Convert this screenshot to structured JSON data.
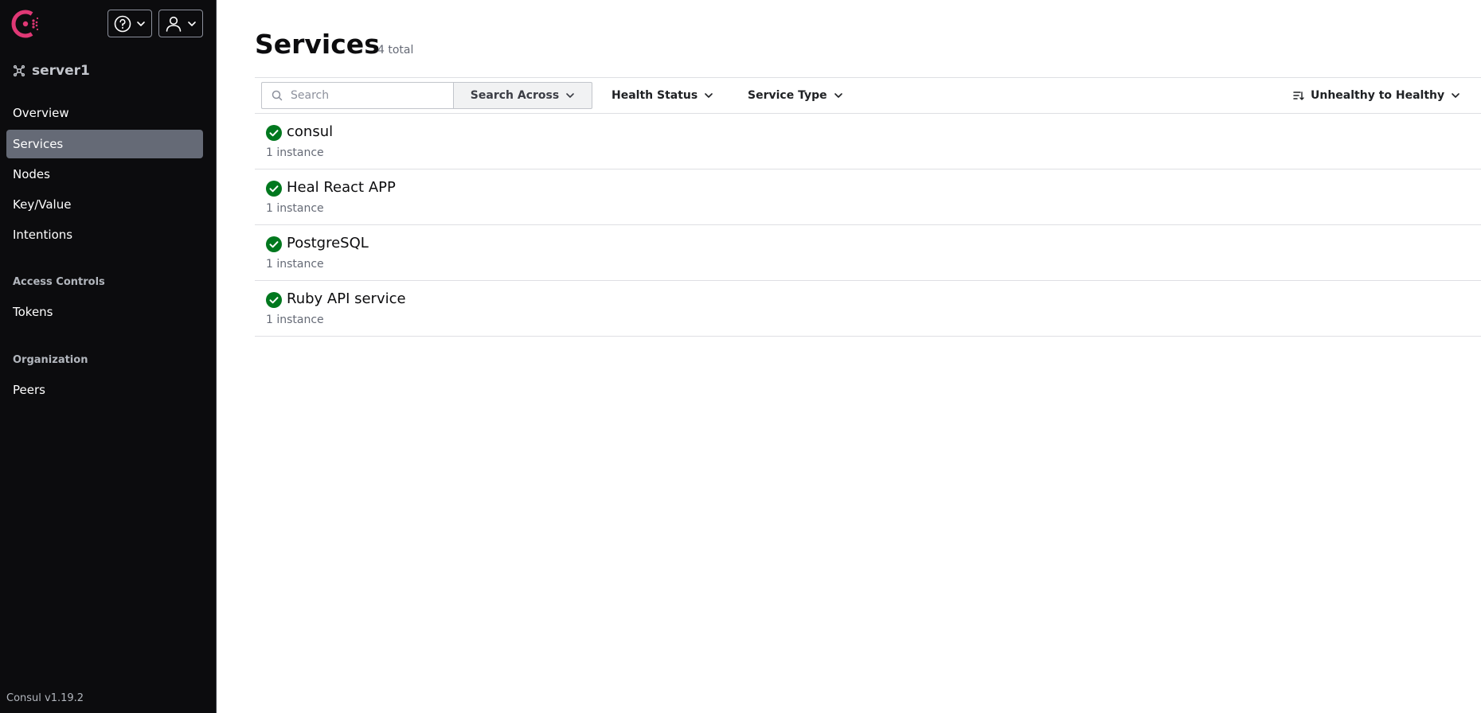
{
  "sidebar": {
    "datacenter": "server1",
    "nav": [
      {
        "label": "Overview",
        "active": false
      },
      {
        "label": "Services",
        "active": true
      },
      {
        "label": "Nodes",
        "active": false
      },
      {
        "label": "Key/Value",
        "active": false
      },
      {
        "label": "Intentions",
        "active": false
      }
    ],
    "access_controls": {
      "heading": "Access Controls",
      "items": [
        "Tokens"
      ]
    },
    "organization": {
      "heading": "Organization",
      "items": [
        "Peers"
      ]
    },
    "version": "Consul v1.19.2"
  },
  "main": {
    "title": "Services",
    "total": "4 total",
    "toolbar": {
      "search_placeholder": "Search",
      "search_across": "Search Across",
      "health_status": "Health Status",
      "service_type": "Service Type",
      "sort": "Unhealthy to Healthy"
    },
    "services": [
      {
        "name": "consul",
        "instances": "1 instance",
        "status": "passing"
      },
      {
        "name": "Heal React APP",
        "instances": "1 instance",
        "status": "passing"
      },
      {
        "name": "PostgreSQL",
        "instances": "1 instance",
        "status": "passing"
      },
      {
        "name": "Ruby API service",
        "instances": "1 instance",
        "status": "passing"
      }
    ]
  },
  "colors": {
    "sidebar_bg": "#0c0c0e",
    "active_nav": "#656a76",
    "brand": "#e03875",
    "passing": "#00781e"
  },
  "icons": [
    "consul-logo-icon",
    "help-icon",
    "user-icon",
    "chevron-down-icon",
    "datacenter-icon",
    "search-icon",
    "sort-icon",
    "check-circle-icon"
  ]
}
